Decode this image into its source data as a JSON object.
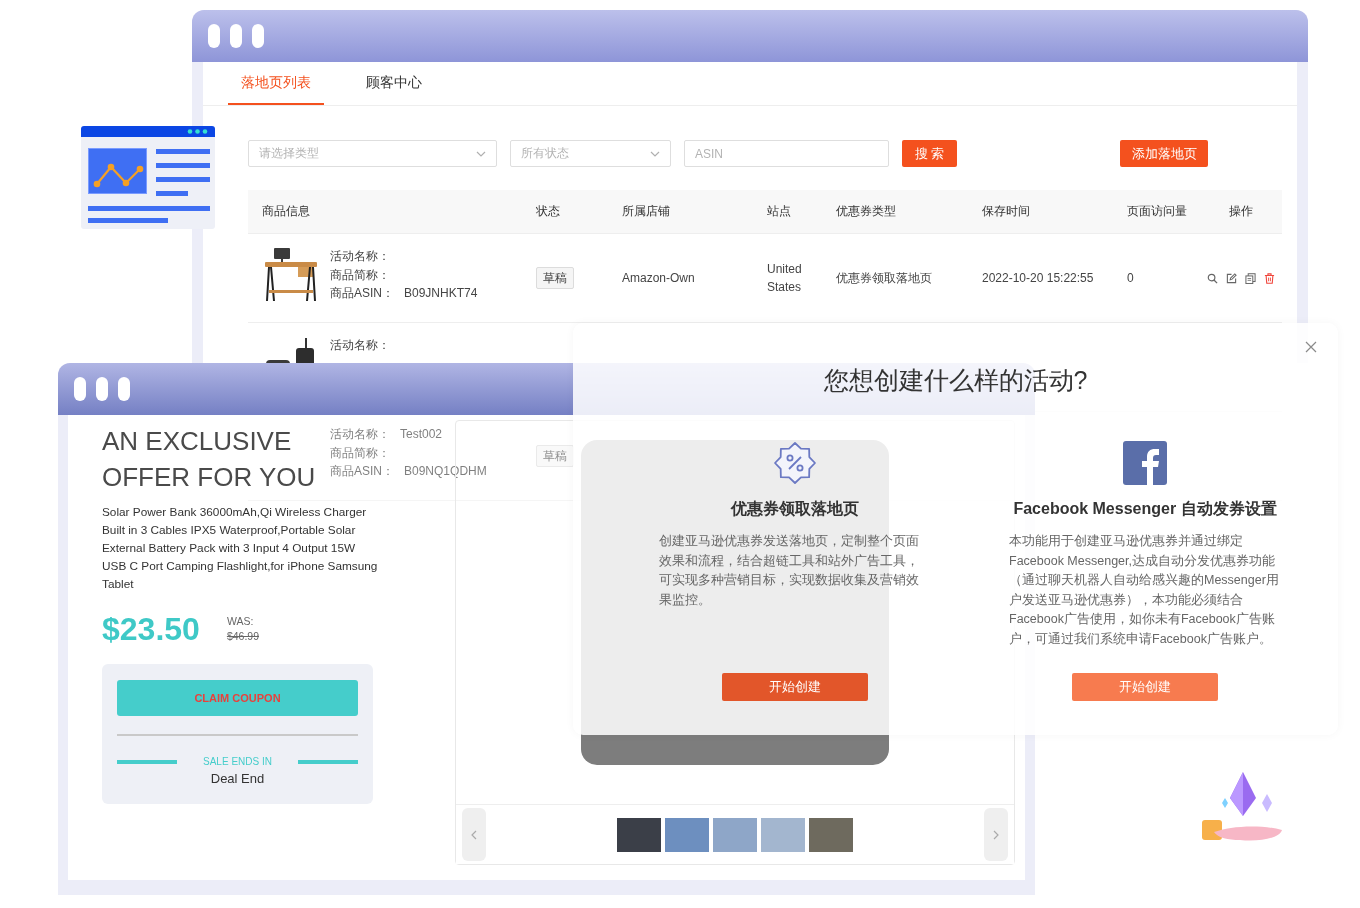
{
  "main_window": {
    "tabs": [
      {
        "label": "落地页列表",
        "selected": true
      },
      {
        "label": "顾客中心",
        "selected": false
      }
    ],
    "filters": {
      "type_select": {
        "placeholder": "请选择类型"
      },
      "status_select": {
        "placeholder": "所有状态"
      },
      "asin_field": {
        "placeholder": "ASIN"
      },
      "search_button": "搜 索",
      "add_button": "添加落地页"
    },
    "table": {
      "columns": [
        "商品信息",
        "状态",
        "所属店铺",
        "站点",
        "优惠券类型",
        "保存时间",
        "页面访问量",
        "操作"
      ],
      "rows": [
        {
          "activity_label": "活动名称：",
          "short_name_label": "商品简称：",
          "asin_label": "商品ASIN：",
          "asin": "B09JNHKT74",
          "status": "草稿",
          "store": "Amazon-Own",
          "site": "United States",
          "coupon_type": "优惠券领取落地页",
          "saved_time": "2022-10-20 15:22:55",
          "views": "0"
        },
        {
          "activity_label": "活动名称："
        },
        {
          "activity_label": "活动名称：",
          "activity_name": "Test002",
          "short_name_label": "商品简称：",
          "asin_label": "商品ASIN：",
          "asin": "B09NQ1QDHM",
          "status": "草稿"
        }
      ]
    }
  },
  "promo_window": {
    "heading": "AN EXCLUSIVE OFFER FOR YOU",
    "description": "Solar Power Bank 36000mAh,Qi Wireless Charger Built in 3 Cables IPX5 Waterproof,Portable Solar External Battery Pack with 3 Input 4 Output 15W USB C Port Camping Flashlight,for iPhone Samsung Tablet",
    "price": "$23.50",
    "was_label": "WAS:",
    "was_price": "$46.99",
    "coupon_button": "CLAIM COUPON",
    "sale_label": "SALE ENDS IN",
    "deal_status": "Deal End"
  },
  "dialog": {
    "title": "您想创建什么样的活动?",
    "options": [
      {
        "kind": "coupon",
        "title": "优惠券领取落地页",
        "description": "创建亚马逊优惠券发送落地页，定制整个页面效果和流程，结合超链工具和站外广告工具，可实现多种营销目标，实现数据收集及营销效果监控。",
        "button": "开始创建",
        "highlighted": true
      },
      {
        "kind": "facebook",
        "title": "Facebook Messenger 自动发券设置",
        "description": "本功能用于创建亚马逊优惠券并通过绑定Facebook Messenger,达成自动分发优惠券功能（通过聊天机器人自动给感兴趣的Messenger用户发送亚马逊优惠券），本功能必须结合Facebook广告使用，如你未有Facebook广告账户，可通过我们系统申请Facebook广告账户。",
        "button": "开始创建",
        "highlighted": false
      }
    ]
  }
}
